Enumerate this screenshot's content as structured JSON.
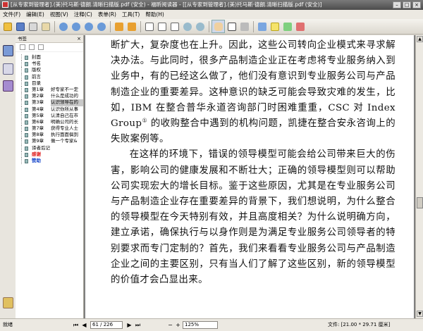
{
  "window": {
    "title": "[从专家到管理者].(美)托马斯·德朗.清晰扫描版.pdf (安全) - 福昕阅读器 - [[从专家到管理者].(美)托马斯·德朗.清晰扫描版.pdf (安全)]",
    "controls": [
      "–",
      "□",
      "×"
    ]
  },
  "menu": [
    "文件(F)",
    "编辑(E)",
    "视图(V)",
    "注释(C)",
    "表单(R)",
    "工具(T)",
    "帮助(H)"
  ],
  "toolbar": {
    "zoom_level": "125%",
    "icons": [
      "open-icon",
      "save-icon",
      "print-icon",
      "email-icon",
      "hand-icon",
      "select-text-icon",
      "snapshot-icon",
      "zoom-in-icon",
      "zoom-out-icon",
      "first-page-icon",
      "prev-page-icon",
      "next-page-icon",
      "last-page-icon",
      "back-icon",
      "forward-icon",
      "fit-page-icon",
      "fit-width-icon",
      "rotate-icon",
      "typewriter-icon",
      "note-icon",
      "highlight-icon",
      "pencil-icon"
    ]
  },
  "sidebar": {
    "title": "书签",
    "close": "×",
    "bookmarks": [
      {
        "label": "封面",
        "title": ""
      },
      {
        "label": "书名",
        "title": ""
      },
      {
        "label": "版权",
        "title": ""
      },
      {
        "label": "前言",
        "title": ""
      },
      {
        "label": "目录",
        "title": ""
      },
      {
        "label": "第1章",
        "title": "好专家不一定"
      },
      {
        "label": "第2章",
        "title": "什么是成功的"
      },
      {
        "label": "第3章",
        "title": "认识领导在的",
        "selected": true
      },
      {
        "label": "第4章",
        "title": "认识你所从事"
      },
      {
        "label": "第5章",
        "title": "认清自己在市"
      },
      {
        "label": "第6章",
        "title": "明确公司的长"
      },
      {
        "label": "第7章",
        "title": "获得专业人士"
      },
      {
        "label": "第8章",
        "title": "执行面面俱到"
      },
      {
        "label": "第9章",
        "title": "做一个专家&"
      },
      {
        "label": "译者后记",
        "title": ""
      },
      {
        "label": "感谢",
        "title": "",
        "style": "red"
      },
      {
        "label": "赞助",
        "title": "",
        "style": "blue"
      }
    ]
  },
  "document": {
    "paragraphs": [
      {
        "indent": false,
        "lines": [
          "断扩大，复杂度也在上升。因此，这些公司转向企业模式来寻求解决办法。与此同时，很多产品制造企业正在考虑将专业服务纳入到业务中，有的已经这么做了，他们没有意识到专业服务公司与产品制造企业的重要差异。这种意识的缺乏可能会导致灾难的发生，比如，IBM 在整合普华永道咨询部门时困难重重，CSC 对 Index Group"
        ],
        "footnote": "①",
        "tail": " 的收购整合中遇到的机构问题，凯捷在整合安永咨询上的失败案例等。"
      },
      {
        "indent": true,
        "text": "在这样的环境下，错误的领导模型可能会给公司带来巨大的伤害，影响公司的健康发展和不断壮大；正确的领导模型则可以帮助公司实现宏大的增长目标。鉴于这些原因，尤其是在专业服务公司与产品制造企业存在重要差异的背景下，我们想说明，为什么整合的领导模型在今天特别有效，并且高度相关？为什么说明确方向，建立承诺，确保执行与以身作则是为满足专业服务公司领导者的特别要求而专门定制的？首先，我们来看看专业服务公司与产品制造企业之间的主要区别，只有当人们了解了这些区别，新的领导模型的价值才会凸显出来。"
      }
    ]
  },
  "status": {
    "text": "就绪",
    "page_indicator": "61 / 226",
    "zoom": "125%",
    "doc_size": "文件: [21.00 * 29.71 厘米]"
  }
}
